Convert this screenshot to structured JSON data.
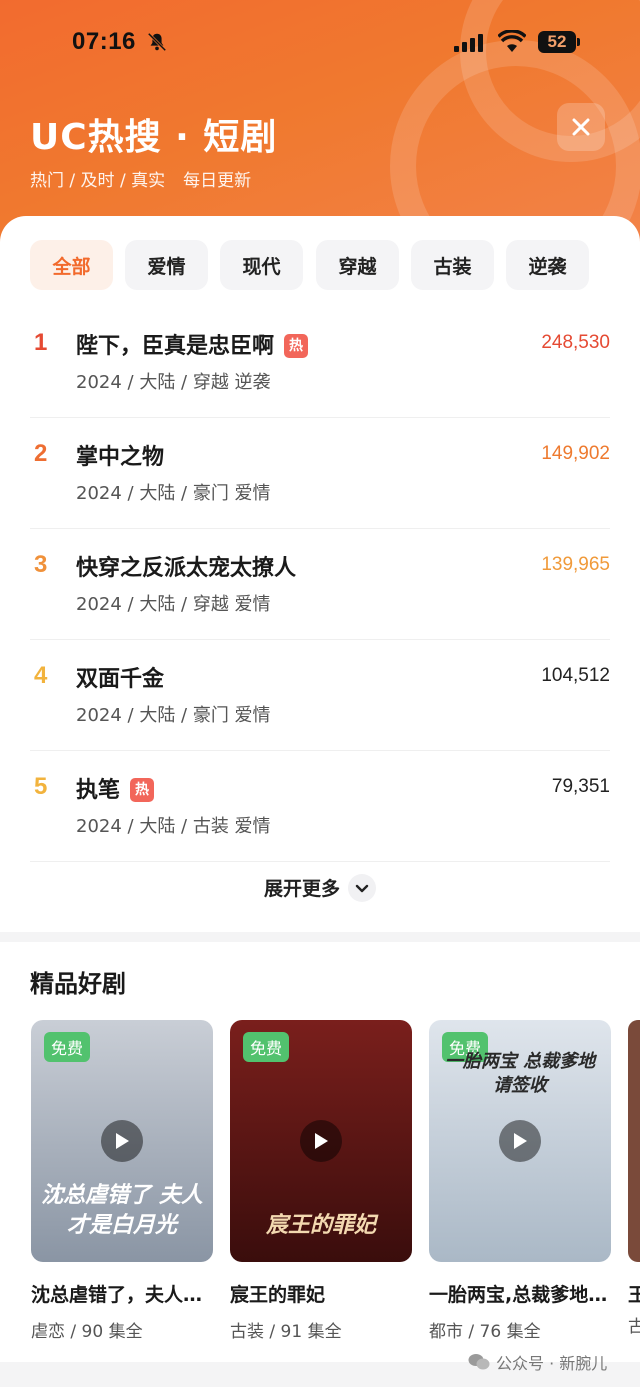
{
  "status_bar": {
    "time": "07:16",
    "battery": "52"
  },
  "header": {
    "brand": "UC热搜 · 短剧",
    "slogan": "热门 / 及时 / 真实",
    "slogan_daily": "每日更新"
  },
  "tabs": [
    {
      "label": "全部",
      "active": true
    },
    {
      "label": "爱情"
    },
    {
      "label": "现代"
    },
    {
      "label": "穿越"
    },
    {
      "label": "古装"
    },
    {
      "label": "逆袭"
    }
  ],
  "ranking": [
    {
      "rank": "1",
      "title": "陛下，臣真是忠臣啊",
      "hot": true,
      "meta": "2024 / 大陆 / 穿越 逆袭",
      "score": "248,530",
      "rank_color": "#e54a33",
      "score_color": "#e54a33"
    },
    {
      "rank": "2",
      "title": "掌中之物",
      "hot": false,
      "meta": "2024 / 大陆 / 豪门 爱情",
      "score": "149,902",
      "rank_color": "#ee6e32",
      "score_color": "#ee7a2f"
    },
    {
      "rank": "3",
      "title": "快穿之反派太宠太撩人",
      "hot": false,
      "meta": "2024 / 大陆 / 穿越 爱情",
      "score": "139,965",
      "rank_color": "#f0913a",
      "score_color": "#f09a3a"
    },
    {
      "rank": "4",
      "title": "双面千金",
      "hot": false,
      "meta": "2024 / 大陆 / 豪门 爱情",
      "score": "104,512",
      "rank_color": "#f2b33d",
      "score_color": "#222222"
    },
    {
      "rank": "5",
      "title": "执笔",
      "hot": true,
      "meta": "2024 / 大陆 / 古装 爱情",
      "score": "79,351",
      "rank_color": "#f2b33d",
      "score_color": "#222222"
    }
  ],
  "hot_badge": "热",
  "expand_label": "展开更多",
  "section": {
    "title": "精品好剧",
    "free_label": "免费",
    "cards": [
      {
        "title": "沈总虐错了，夫人才是白月光",
        "meta": "虐恋 / 90 集全",
        "art": "沈总虐错了 夫人才是白月光",
        "colors": [
          "#c9ced6",
          "#8a95a4"
        ],
        "art_color": "#ffffff"
      },
      {
        "title": "宸王的罪妃",
        "meta": "古装 / 91 集全",
        "art": "宸王的罪妃",
        "colors": [
          "#7a1f1c",
          "#3a0d0c"
        ],
        "art_color": "#f3d9b0"
      },
      {
        "title": "一胎两宝,总裁爹地请签收",
        "meta": "都市 / 76 集全",
        "art": "一胎两宝 总裁爹地请签收",
        "colors": [
          "#dfe5ec",
          "#aab8c6"
        ],
        "art_color": "#2a2a2a"
      }
    ],
    "peek_title": "王",
    "peek_meta": "古"
  },
  "watermark": "公众号 · 新腕儿"
}
